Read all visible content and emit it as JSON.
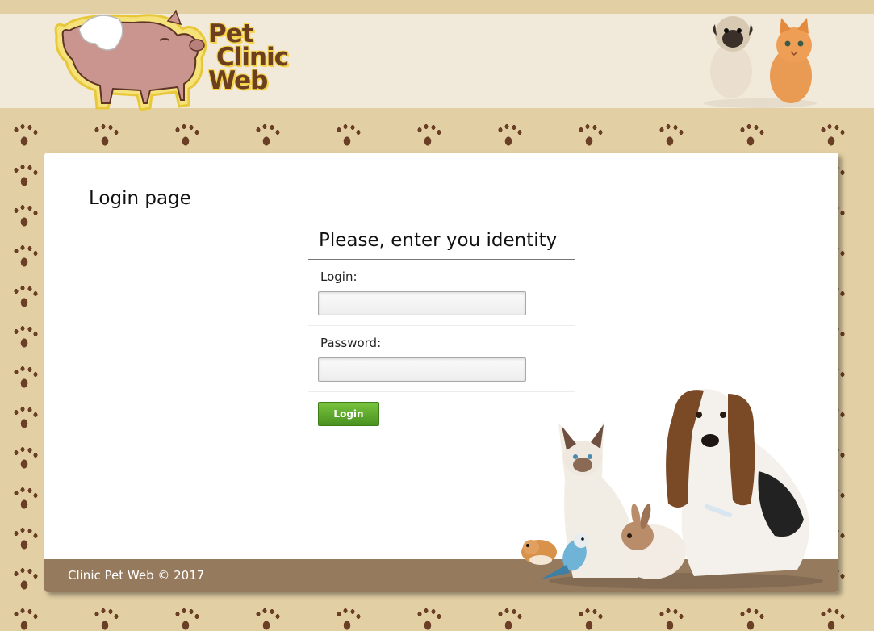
{
  "header": {
    "logo_lines": [
      "Pet",
      "Clinic",
      "Web"
    ]
  },
  "main": {
    "page_title": "Login page",
    "form_title": "Please, enter you identity",
    "login_label": "Login:",
    "login_value": "",
    "password_label": "Password:",
    "password_value": "",
    "login_button": "Login"
  },
  "footer": {
    "copyright": "Clinic Pet Web © 2017"
  },
  "colors": {
    "background": "#e2cfa4",
    "paw": "#6b3f26",
    "header_band": "#f1eadb",
    "footer": "#957a5e",
    "button": "#5aa52a"
  }
}
